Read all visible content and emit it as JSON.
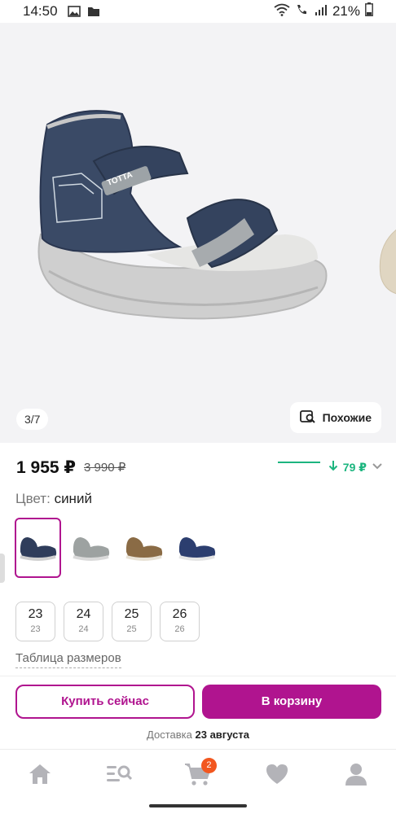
{
  "status_bar": {
    "time": "14:50",
    "battery": "21%"
  },
  "gallery": {
    "counter": "3/7",
    "similar_label": "Похожие"
  },
  "price": {
    "current": "1 955 ₽",
    "old": "3 990 ₽",
    "history_drop": "79 ₽"
  },
  "color": {
    "label": "Цвет:",
    "value": "синий"
  },
  "variants": [
    {
      "selected": true,
      "color": "#2f3d5b"
    },
    {
      "selected": false,
      "color": "#9da2a1"
    },
    {
      "selected": false,
      "color": "#8a6b45"
    },
    {
      "selected": false,
      "color": "#2c3e6f"
    }
  ],
  "sizes": [
    {
      "size": "23",
      "sub": "23"
    },
    {
      "size": "24",
      "sub": "24"
    },
    {
      "size": "25",
      "sub": "25"
    },
    {
      "size": "26",
      "sub": "26"
    }
  ],
  "size_table_label": "Таблица размеров",
  "actions": {
    "buy_now": "Купить сейчас",
    "add_to_cart": "В корзину"
  },
  "delivery": {
    "label": "Доставка",
    "date": "23 августа"
  },
  "nav": {
    "cart_badge": "2"
  },
  "colors": {
    "accent": "#b0148f",
    "price_drop": "#1cb57f",
    "badge": "#f2571f"
  }
}
